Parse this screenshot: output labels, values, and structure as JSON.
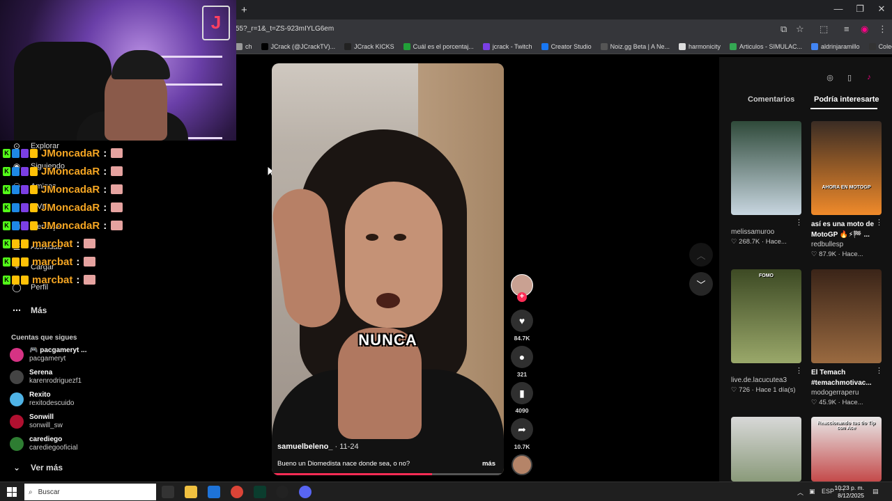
{
  "browser": {
    "new_tab_label": "+",
    "url": "55?_r=1&_t=ZS-923mIYLG6em",
    "window_controls": [
      "—",
      "❐",
      "✕"
    ],
    "bookmarks": [
      {
        "label": "ch",
        "color": "#999999"
      },
      {
        "label": "JCrack (@JCrackTV)...",
        "color": "#000000"
      },
      {
        "label": "JCrack KICKS",
        "color": "#222222"
      },
      {
        "label": "Cuál es el porcentaj...",
        "color": "#21a038"
      },
      {
        "label": "jcrack - Twitch",
        "color": "#7b3fe4"
      },
      {
        "label": "Creator Studio",
        "color": "#1877f2"
      },
      {
        "label": "Noiz.gg Beta | A Ne...",
        "color": "#555555"
      },
      {
        "label": "harmonicity",
        "color": "#dddddd"
      },
      {
        "label": "Articulos - SIMULAC...",
        "color": "#34a853"
      },
      {
        "label": "aldrinjaramillo",
        "color": "#4285f4"
      },
      {
        "label": "Colección de M_blei...",
        "color": "#333333"
      }
    ],
    "bookmarks_overflow": "»"
  },
  "nav": {
    "items": [
      {
        "label": "Explorar",
        "icon": "compass-icon"
      },
      {
        "label": "Siguiendo",
        "icon": "following-icon"
      },
      {
        "label": "Amigos",
        "icon": "friends-icon"
      },
      {
        "label": "LIVE",
        "icon": "live-icon"
      },
      {
        "label": "Mensajes",
        "icon": "messages-icon"
      },
      {
        "label": "Actividad",
        "icon": "activity-icon"
      },
      {
        "label": "Cargar",
        "icon": "upload-icon"
      },
      {
        "label": "Perfil",
        "icon": "profile-icon"
      }
    ],
    "more_label": "Más",
    "following_title": "Cuentas que sigues",
    "following": [
      {
        "name": "🎮 pacgameryt ...",
        "handle": "pacgameryt",
        "color": "#d63384"
      },
      {
        "name": "Serena",
        "handle": "karenrodriguezf1",
        "color": "#444444"
      },
      {
        "name": "Rexito",
        "handle": "rexitodescuido",
        "color": "#4fb3e6"
      },
      {
        "name": "Sonwill",
        "handle": "sonwill_sw",
        "color": "#b01030"
      },
      {
        "name": "carediego",
        "handle": "carediegooficial",
        "color": "#2e7d32"
      }
    ],
    "see_more_label": "Ver más"
  },
  "chat": [
    {
      "user": "JMoncadaR",
      "sep": ":"
    },
    {
      "user": "JMoncadaR",
      "sep": ":"
    },
    {
      "user": "JMoncadaR",
      "sep": ":"
    },
    {
      "user": "JMoncadaR",
      "sep": ":"
    },
    {
      "user": "JMoncadaR",
      "sep": ":"
    },
    {
      "user": "marcbat",
      "sep": ":"
    },
    {
      "user": "marcbat",
      "sep": ":"
    },
    {
      "user": "marcbat",
      "sep": ":"
    }
  ],
  "video": {
    "caption_overlay": "NUNCA",
    "author": "samuelbeleno_",
    "date": " · 11-24",
    "description": "Bueno un Diomedista nace donde sea, o no?",
    "more_label": "más",
    "progress": 0.69,
    "likes": "84.7K",
    "comments": "321",
    "saves": "4090",
    "shares": "10.7K"
  },
  "right_panel": {
    "tabs": [
      "Comentarios",
      "Podría interesarte"
    ],
    "active_tab": 1,
    "recommendations": [
      {
        "title": "",
        "user": "melissamuroo",
        "likes": "268.7K",
        "time": "Hace...",
        "colors": [
          "#2f4a3a",
          "#c8d6e0"
        ]
      },
      {
        "title": "así es una moto de MotoGP 🔥⚡🏁 ...",
        "user": "redbullesp",
        "likes": "87.9K",
        "time": "Hace...",
        "colors": [
          "#3a2c24",
          "#f08a2a"
        ],
        "thumb_text": "AHORA EN MOTOGP"
      },
      {
        "title": "",
        "user": "live.de.lacucutea3",
        "likes": "726",
        "time": "Hace 1 día(s)",
        "colors": [
          "#3d4a24",
          "#9aa86a"
        ],
        "thumb_text": "FOMO"
      },
      {
        "title": "El Temach #temachmotivac...",
        "user": "modogerraperu",
        "likes": "45.9K",
        "time": "Hace...",
        "colors": [
          "#3a2418",
          "#9a6a40"
        ]
      },
      {
        "title": "",
        "user": "",
        "likes": "",
        "time": "",
        "colors": [
          "#d8d8d8",
          "#8a9a7a"
        ]
      },
      {
        "title": "",
        "user": "",
        "likes": "",
        "time": "",
        "colors": [
          "#e8e8e8",
          "#c44a4a"
        ],
        "thumb_text": "Reaccionando tus tio Tip con Ace"
      }
    ]
  },
  "taskbar": {
    "search_placeholder": "Buscar",
    "lang": "ESP",
    "time": "10:23 p. m.",
    "date": "8/12/2025"
  }
}
